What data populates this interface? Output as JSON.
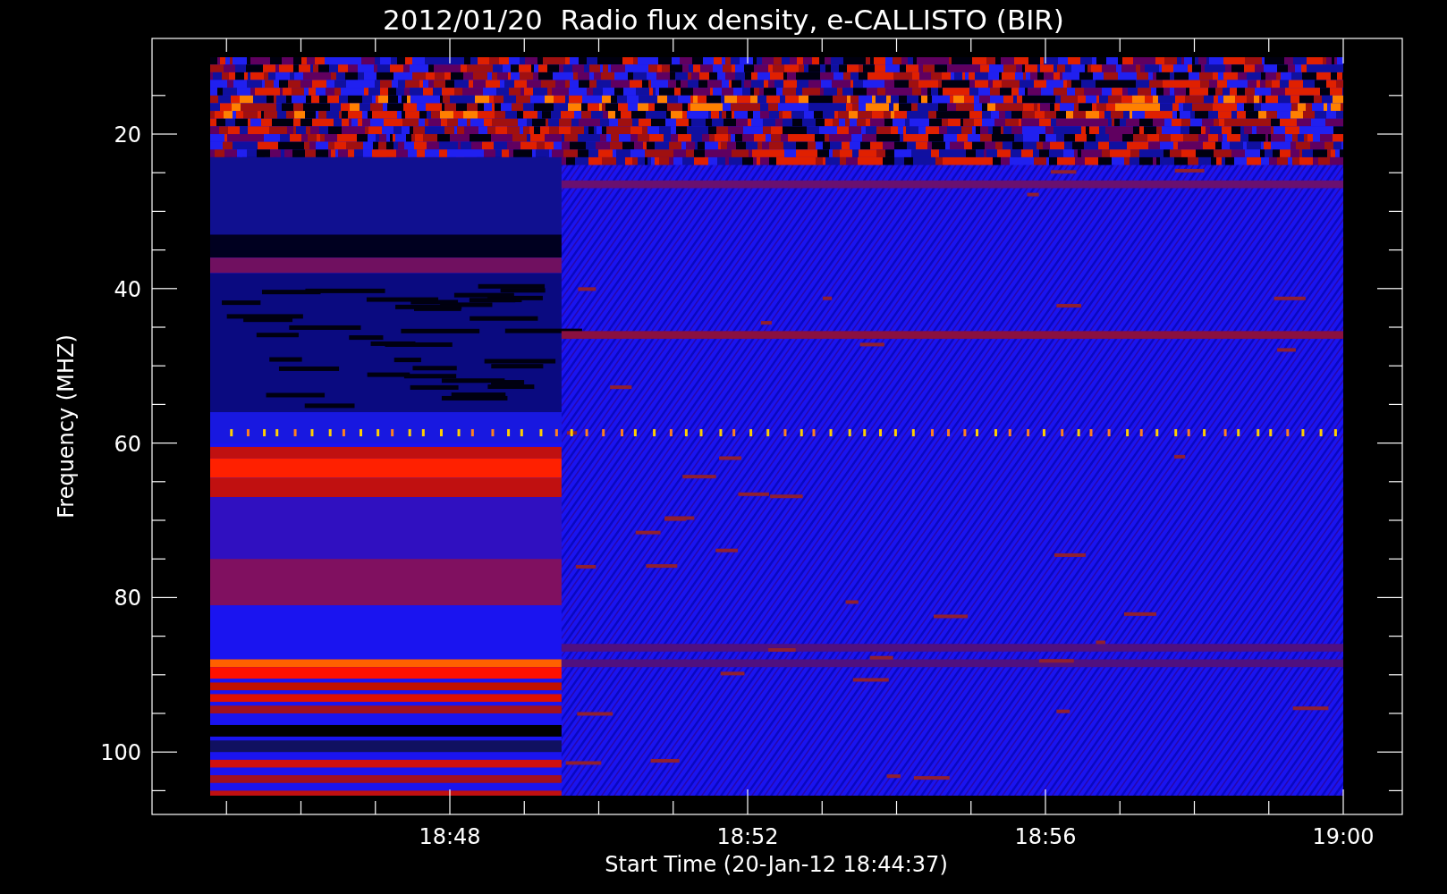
{
  "title": "2012/01/20  Radio flux density, e-CALLISTO (BIR)",
  "y_axis": {
    "label": "Frequency (MHZ)",
    "ticks": [
      "20",
      "40",
      "60",
      "80",
      "100"
    ]
  },
  "x_axis": {
    "label": "Start Time (20-Jan-12 18:44:37)",
    "ticks": [
      "18:48",
      "18:52",
      "18:56",
      "19:00"
    ]
  }
}
